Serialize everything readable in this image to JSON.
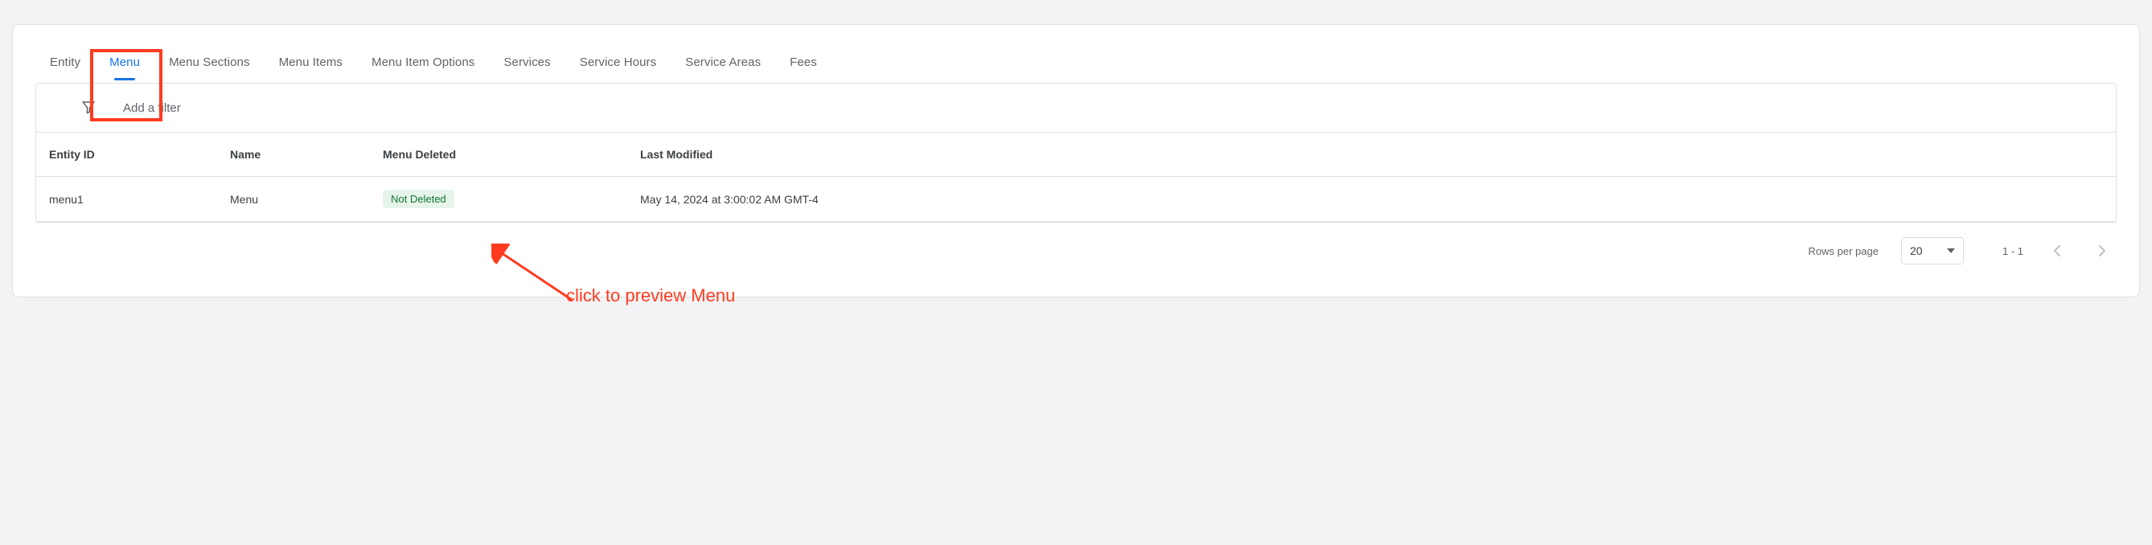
{
  "tabs": [
    {
      "label": "Entity"
    },
    {
      "label": "Menu"
    },
    {
      "label": "Menu Sections"
    },
    {
      "label": "Menu Items"
    },
    {
      "label": "Menu Item Options"
    },
    {
      "label": "Services"
    },
    {
      "label": "Service Hours"
    },
    {
      "label": "Service Areas"
    },
    {
      "label": "Fees"
    }
  ],
  "active_tab_index": 1,
  "filter": {
    "placeholder": "Add a filter"
  },
  "table": {
    "headers": {
      "entity_id": "Entity ID",
      "name": "Name",
      "menu_deleted": "Menu Deleted",
      "last_modified": "Last Modified"
    },
    "rows": [
      {
        "entity_id": "menu1",
        "name": "Menu",
        "menu_deleted": "Not Deleted",
        "last_modified": "May 14, 2024 at 3:00:02 AM GMT-4"
      }
    ]
  },
  "pager": {
    "label": "Rows per page",
    "value": "20",
    "range": "1 - 1"
  },
  "annotation": {
    "text": "click to preview Menu"
  }
}
